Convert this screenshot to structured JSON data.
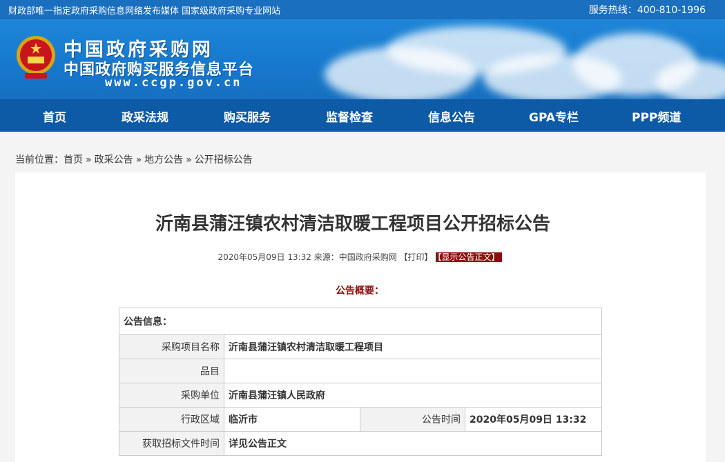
{
  "topbar": {
    "left_text": "财政部唯一指定政府采购信息网络发布媒体 国家级政府采购专业网站",
    "hotline": "服务热线：400-810-1996"
  },
  "logo": {
    "title": "中国政府采购网",
    "subtitle": "中国政府购买服务信息平台",
    "url": "www.ccgp.gov.cn"
  },
  "nav": {
    "items": [
      "首页",
      "政采法规",
      "购买服务",
      "监督检查",
      "信息公告",
      "GPA专栏",
      "PPP频道"
    ]
  },
  "breadcrumb": {
    "prefix": "当前位置：",
    "items": [
      "首页",
      "政采公告",
      "地方公告",
      "公开招标公告"
    ],
    "separator": "»"
  },
  "article": {
    "title": "沂南县蒲汪镇农村清洁取暖工程项目公开招标公告",
    "meta": "2020年05月09日 13:32 来源：中国政府采购网 【打印】",
    "show_text_button": "【显示公告正文】",
    "summary_heading": "公告概要："
  },
  "info_table": {
    "header": "公告信息：",
    "rows": [
      {
        "label": "采购项目名称",
        "value": "沂南县蒲汪镇农村清洁取暖工程项目"
      },
      {
        "label": "品目",
        "value": ""
      },
      {
        "label": "采购单位",
        "value": "沂南县蒲汪镇人民政府"
      },
      {
        "label": "行政区域",
        "value": "临沂市",
        "label2": "公告时间",
        "value2": "2020年05月09日 13:32"
      },
      {
        "label": "获取招标文件时间",
        "value": "详见公告正文"
      }
    ]
  },
  "colors": {
    "topbar": "#1a6fbf",
    "nav": "#0d5aa7",
    "accent_red": "#8e0d0d"
  }
}
